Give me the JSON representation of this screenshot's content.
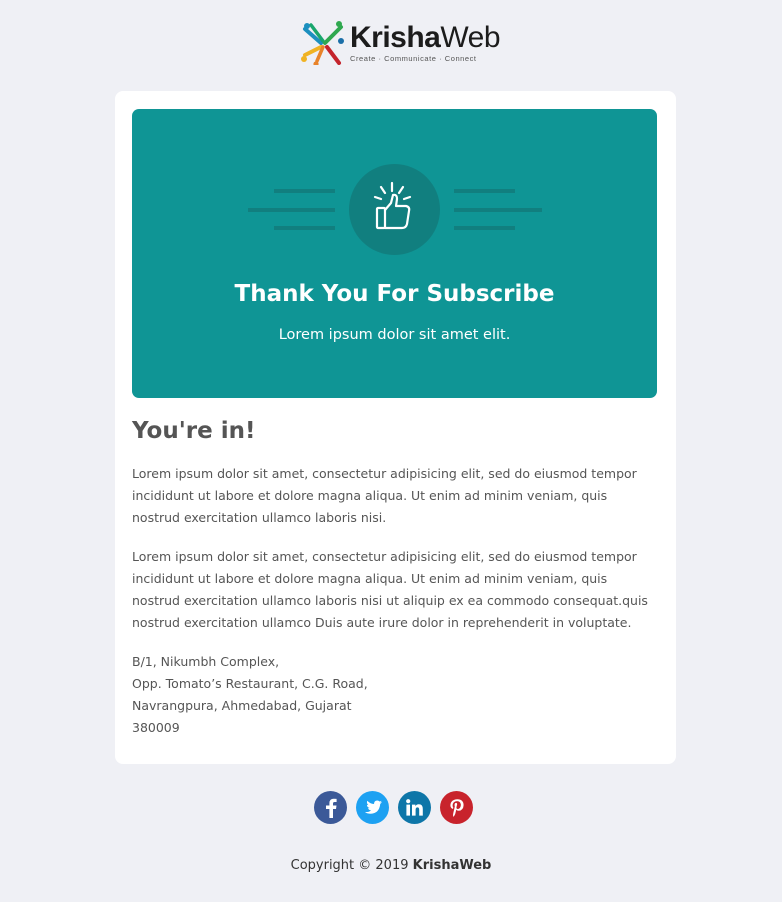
{
  "brand": {
    "name_bold": "Krisha",
    "name_regular": "Web",
    "tagline": "Create · Communicate · Connect"
  },
  "hero": {
    "title": "Thank You For Subscribe",
    "subtitle": "Lorem ipsum dolor sit amet elit.",
    "icon": "thumbs-up-icon",
    "background": "#0f9595"
  },
  "content": {
    "heading": "You're in!",
    "paragraphs": [
      "Lorem ipsum dolor sit amet, consectetur adipisicing elit, sed do eiusmod tempor incididunt ut labore et dolore magna aliqua. Ut enim ad minim veniam, quis nostrud exercitation ullamco laboris nisi.",
      "Lorem ipsum dolor sit amet, consectetur adipisicing elit, sed do eiusmod tempor incididunt ut labore et dolore magna aliqua. Ut enim ad minim veniam, quis nostrud exercitation ullamco laboris nisi ut aliquip ex ea commodo consequat.quis nostrud exercitation ullamco Duis aute irure dolor in reprehenderit in voluptate."
    ],
    "address": [
      "B/1, Nikumbh Complex,",
      "Opp. Tomato’s Restaurant, C.G. Road,",
      "Navrangpura, Ahmedabad, Gujarat",
      "380009"
    ]
  },
  "social": [
    {
      "name": "facebook",
      "icon": "facebook-icon",
      "color": "#3b5998"
    },
    {
      "name": "twitter",
      "icon": "twitter-icon",
      "color": "#1da1f2"
    },
    {
      "name": "linkedin",
      "icon": "linkedin-icon",
      "color": "#0e76a8"
    },
    {
      "name": "pinterest",
      "icon": "pinterest-icon",
      "color": "#c8232c"
    }
  ],
  "footer": {
    "copyright": "Copyright © 2019 ",
    "brand": "KrishaWeb"
  }
}
